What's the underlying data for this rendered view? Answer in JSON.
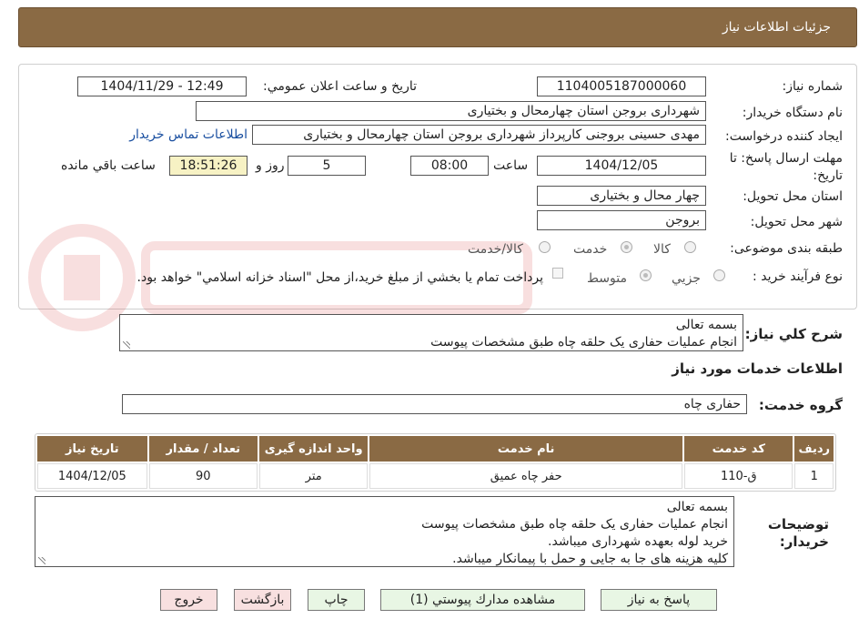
{
  "header": {
    "title": "جزئيات اطلاعات نياز"
  },
  "need_number": {
    "label": "شماره نياز:",
    "value": "1104005187000060"
  },
  "announce": {
    "label": "تاريخ و ساعت اعلان عمومي:",
    "value": "1404/11/29 - 12:49"
  },
  "buyer_org": {
    "label": "نام دستگاه خريدار:",
    "value": "شهرداری بروجن استان چهارمحال و بختیاری"
  },
  "requester": {
    "label": "ايجاد كننده درخواست:",
    "value": "مهدی حسینی بروجنی کارپرداز شهرداری بروجن استان چهارمحال و بختیاری",
    "contact_link": "اطلاعات تماس خريدار"
  },
  "deadline": {
    "label_line1": "مهلت ارسال پاسخ: تا",
    "label_line2": "تاريخ:",
    "date": "1404/12/05",
    "time_label": "ساعت",
    "time": "08:00",
    "days": "5",
    "days_label": "روز و",
    "remaining": "18:51:26",
    "remaining_label": "ساعت باقي مانده"
  },
  "province": {
    "label": "استان محل تحويل:",
    "value": "چهار محال و بختیاری"
  },
  "city": {
    "label": "شهر محل تحويل:",
    "value": "بروجن"
  },
  "category": {
    "label": "طبقه بندی موضوعی:",
    "options": [
      "كالا",
      "خدمت",
      "كالا/خدمت"
    ],
    "selected": "خدمت"
  },
  "purchase_type": {
    "label": "نوع فرآيند خريد :",
    "options": [
      "جزيي",
      "متوسط"
    ],
    "selected": "متوسط",
    "note": "پرداخت تمام يا بخشي از مبلغ خريد،از محل \"اسناد خزانه اسلامي\" خواهد بود."
  },
  "description": {
    "label": "شرح كلي نياز:",
    "lines": [
      "بسمه تعالی",
      "انجام عملیات حفاری یک حلقه چاه طبق مشخصات پیوست"
    ]
  },
  "services_title": "اطلاعات خدمات مورد نياز",
  "service_group": {
    "label": "گروه خدمت:",
    "value": "حفاری چاه"
  },
  "table": {
    "headers": [
      "رديف",
      "كد خدمت",
      "نام خدمت",
      "واحد اندازه گيری",
      "تعداد / مقدار",
      "تاريخ نياز"
    ],
    "rows": [
      [
        "1",
        "ق-110",
        "حفر چاه عمیق",
        "متر",
        "90",
        "1404/12/05"
      ]
    ]
  },
  "buyer_notes": {
    "label_line1": "توضيحات",
    "label_line2": "خريدار:",
    "lines": [
      "بسمه تعالی",
      "انجام عملیات حفاری یک حلقه چاه طبق مشخصات پیوست",
      "خرید لوله بعهده شهرداری میباشد.",
      "کلیه هزینه های جا به جایی و حمل با پیمانکار میباشد."
    ]
  },
  "buttons": {
    "reply": "پاسخ به نياز",
    "attachments": "مشاهده مدارك پيوستي (1)",
    "print": "چاپ",
    "back": "بازگشت",
    "exit": "خروج"
  }
}
